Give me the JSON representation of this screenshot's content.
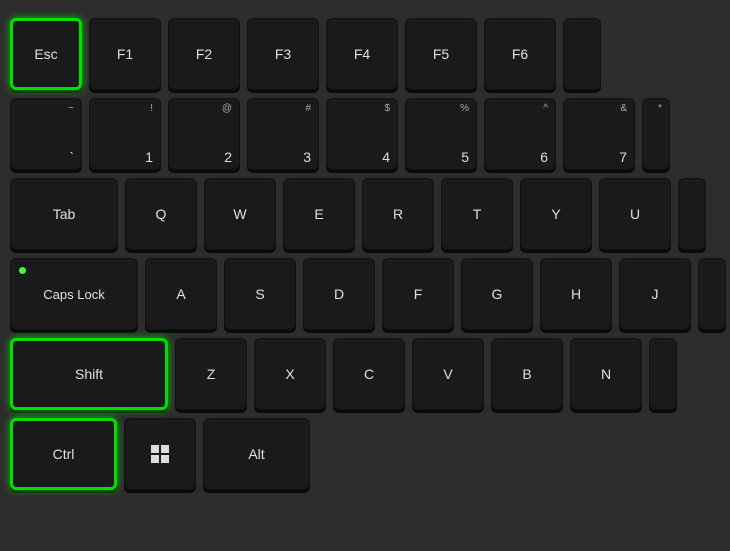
{
  "keyboard": {
    "background": "#2d2d2d",
    "rows": [
      {
        "id": "row-esc",
        "keys": [
          {
            "id": "esc",
            "label": "Esc",
            "highlighted": true,
            "type": "single"
          },
          {
            "id": "f1",
            "label": "F1",
            "highlighted": false,
            "type": "single"
          },
          {
            "id": "f2",
            "label": "F2",
            "highlighted": false,
            "type": "single"
          },
          {
            "id": "f3",
            "label": "F3",
            "highlighted": false,
            "type": "single"
          },
          {
            "id": "f4",
            "label": "F4",
            "highlighted": false,
            "type": "single"
          },
          {
            "id": "f5",
            "label": "F5",
            "highlighted": false,
            "type": "single"
          },
          {
            "id": "f6",
            "label": "F6",
            "highlighted": false,
            "type": "single"
          },
          {
            "id": "f6-partial",
            "label": "",
            "highlighted": false,
            "type": "partial"
          }
        ]
      },
      {
        "id": "row-numbers",
        "keys": [
          {
            "id": "tilde",
            "top": "~",
            "bottom": "`",
            "highlighted": false
          },
          {
            "id": "1",
            "top": "!",
            "bottom": "1",
            "highlighted": false
          },
          {
            "id": "2",
            "top": "@",
            "bottom": "2",
            "highlighted": false
          },
          {
            "id": "3",
            "top": "#",
            "bottom": "3",
            "highlighted": false
          },
          {
            "id": "4",
            "top": "$",
            "bottom": "4",
            "highlighted": false
          },
          {
            "id": "5",
            "top": "%",
            "bottom": "5",
            "highlighted": false
          },
          {
            "id": "6",
            "top": "^",
            "bottom": "6",
            "highlighted": false
          },
          {
            "id": "7",
            "top": "&",
            "bottom": "7",
            "highlighted": false
          },
          {
            "id": "7-partial",
            "top": "",
            "bottom": "",
            "highlighted": false,
            "partial": true
          }
        ]
      },
      {
        "id": "row-tab",
        "keys": [
          {
            "id": "tab",
            "label": "Tab",
            "wide": true
          },
          {
            "id": "q",
            "label": "Q"
          },
          {
            "id": "w",
            "label": "W"
          },
          {
            "id": "e",
            "label": "E"
          },
          {
            "id": "r",
            "label": "R"
          },
          {
            "id": "t",
            "label": "T"
          },
          {
            "id": "y",
            "label": "Y"
          },
          {
            "id": "u",
            "label": "U"
          },
          {
            "id": "u-partial",
            "label": "",
            "partial": true
          }
        ]
      },
      {
        "id": "row-caps",
        "keys": [
          {
            "id": "caps",
            "label": "Caps Lock",
            "highlighted": false,
            "hasDot": true
          },
          {
            "id": "a",
            "label": "A"
          },
          {
            "id": "s",
            "label": "S"
          },
          {
            "id": "d",
            "label": "D"
          },
          {
            "id": "f",
            "label": "F"
          },
          {
            "id": "g",
            "label": "G"
          },
          {
            "id": "h",
            "label": "H"
          },
          {
            "id": "j",
            "label": "J"
          },
          {
            "id": "j-partial",
            "label": "",
            "partial": true
          }
        ]
      },
      {
        "id": "row-shift",
        "keys": [
          {
            "id": "shift",
            "label": "Shift",
            "highlighted": true
          },
          {
            "id": "z",
            "label": "Z"
          },
          {
            "id": "x",
            "label": "X"
          },
          {
            "id": "c",
            "label": "C"
          },
          {
            "id": "v",
            "label": "V"
          },
          {
            "id": "b",
            "label": "B"
          },
          {
            "id": "n",
            "label": "N"
          },
          {
            "id": "n-partial",
            "label": "",
            "partial": true
          }
        ]
      },
      {
        "id": "row-ctrl",
        "keys": [
          {
            "id": "ctrl",
            "label": "Ctrl",
            "highlighted": true
          },
          {
            "id": "win",
            "label": "win",
            "isWin": true
          },
          {
            "id": "alt",
            "label": "Alt"
          }
        ]
      }
    ]
  }
}
